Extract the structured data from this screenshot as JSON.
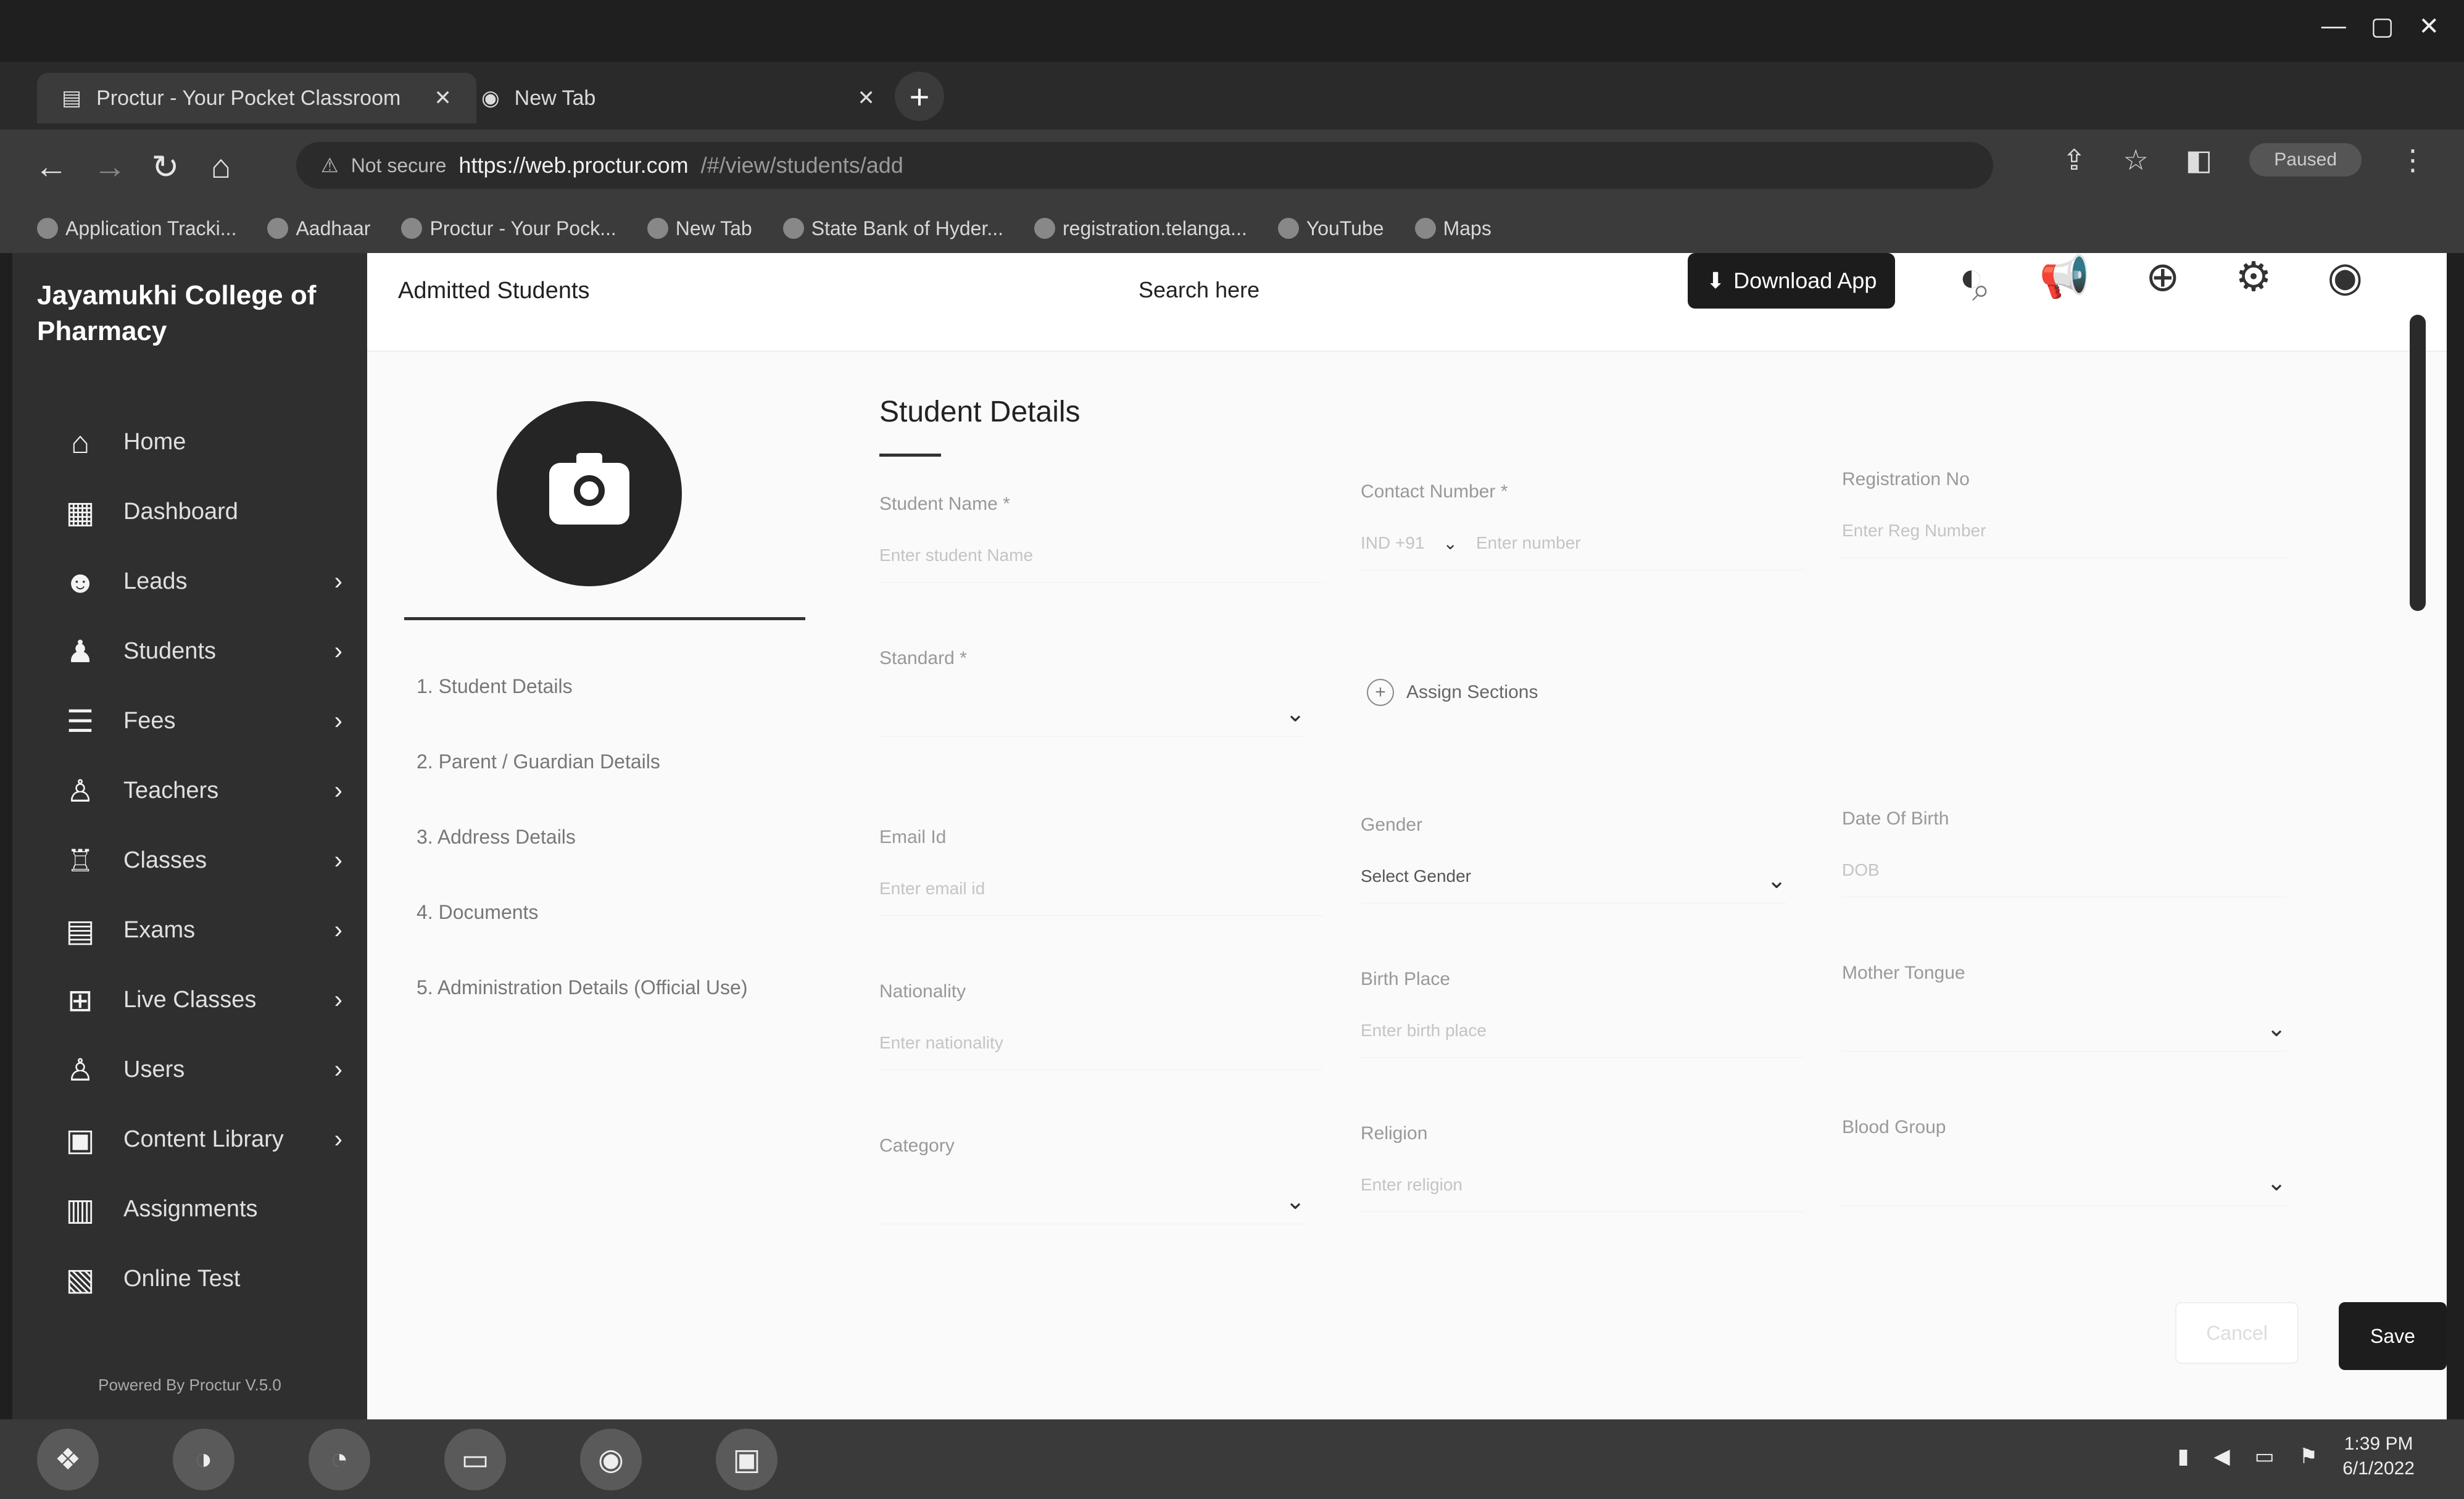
{
  "browser": {
    "tabs": [
      {
        "label": "Proctur - Your Pocket Classroom"
      },
      {
        "label": "New Tab"
      }
    ],
    "url": {
      "warning": "Not secure",
      "host": "https://web.proctur.com",
      "path": "/#/view/students/add"
    },
    "profile": "Paused",
    "bookmarks": [
      "Application Tracki...",
      "Aadhaar",
      "Proctur - Your Pock...",
      "New Tab",
      "State Bank of Hyder...",
      "registration.telanga...",
      "YouTube",
      "Maps"
    ]
  },
  "sidebar": {
    "brand": "Jayamukhi College of Pharmacy",
    "items": [
      {
        "label": "Home",
        "icon": "home-icon",
        "chevron": false
      },
      {
        "label": "Dashboard",
        "icon": "dashboard-icon",
        "chevron": false
      },
      {
        "label": "Leads",
        "icon": "leads-icon",
        "chevron": true
      },
      {
        "label": "Students",
        "icon": "students-icon",
        "chevron": true
      },
      {
        "label": "Fees",
        "icon": "fees-icon",
        "chevron": true
      },
      {
        "label": "Teachers",
        "icon": "teachers-icon",
        "chevron": true
      },
      {
        "label": "Classes",
        "icon": "classes-icon",
        "chevron": true
      },
      {
        "label": "Exams",
        "icon": "exams-icon",
        "chevron": true
      },
      {
        "label": "Live Classes",
        "icon": "live-classes-icon",
        "chevron": true
      },
      {
        "label": "Users",
        "icon": "users-icon",
        "chevron": true
      },
      {
        "label": "Content Library",
        "icon": "content-library-icon",
        "chevron": true
      },
      {
        "label": "Assignments",
        "icon": "assignments-icon",
        "chevron": false
      },
      {
        "label": "Online Test",
        "icon": "online-test-icon",
        "chevron": false
      }
    ],
    "powered": "Powered By Proctur V.5.0"
  },
  "header": {
    "breadcrumb": "Admitted Students",
    "search_placeholder": "Search here",
    "download_label": "Download App"
  },
  "steps": [
    "1. Student Details",
    "2. Parent / Guardian Details",
    "3. Address Details",
    "4. Documents",
    "5. Administration Details (Official Use)"
  ],
  "form": {
    "title": "Student Details",
    "fields": {
      "student_name": {
        "label": "Student Name *",
        "placeholder": "Enter student Name"
      },
      "contact_number": {
        "label": "Contact Number *",
        "prefix": "IND +91",
        "placeholder": "Enter number"
      },
      "registration_no": {
        "label": "Registration No",
        "placeholder": "Enter Reg Number"
      },
      "standard": {
        "label": "Standard *",
        "placeholder": ""
      },
      "assign_sections": {
        "label": "Assign Sections"
      },
      "email": {
        "label": "Email Id",
        "placeholder": "Enter email id"
      },
      "gender": {
        "label": "Gender",
        "placeholder": "Select Gender"
      },
      "dob": {
        "label": "Date Of Birth",
        "placeholder": "DOB"
      },
      "nationality": {
        "label": "Nationality",
        "placeholder": "Enter nationality"
      },
      "birth_place": {
        "label": "Birth Place",
        "placeholder": "Enter birth place"
      },
      "mother_tongue": {
        "label": "Mother Tongue",
        "placeholder": ""
      },
      "category": {
        "label": "Category",
        "placeholder": ""
      },
      "religion": {
        "label": "Religion",
        "placeholder": "Enter religion"
      },
      "blood_group": {
        "label": "Blood Group",
        "placeholder": ""
      }
    },
    "cancel_label": "Cancel",
    "save_label": "Save"
  },
  "taskbar": {
    "time": "1:39 PM",
    "date": "6/1/2022"
  }
}
